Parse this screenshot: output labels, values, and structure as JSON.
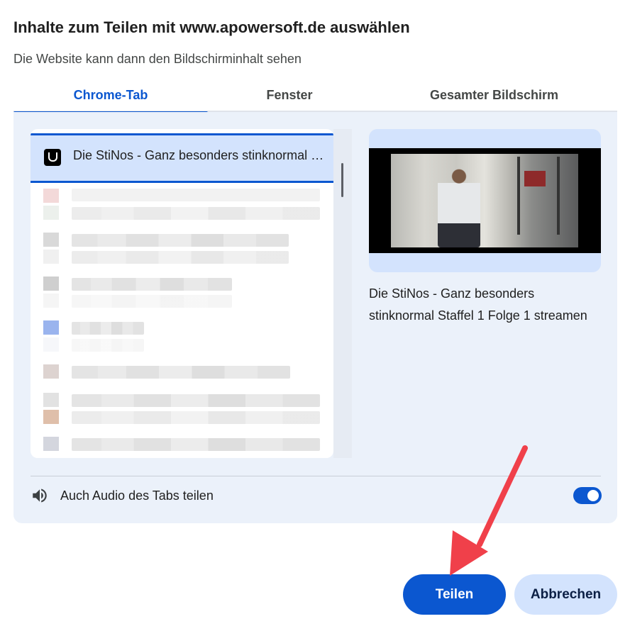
{
  "dialog": {
    "title": "Inhalte zum Teilen mit www.apowersoft.de auswählen",
    "subtitle": "Die Website kann dann den Bildschirminhalt sehen"
  },
  "tabs": [
    {
      "label": "Chrome-Tab",
      "active": true
    },
    {
      "label": "Fenster",
      "active": false
    },
    {
      "label": "Gesamter Bildschirm",
      "active": false
    }
  ],
  "tab_list": {
    "selected_item": {
      "label": "Die StiNos - Ganz besonders stinknormal Staffel 1 Folge 1 streamen",
      "icon": "stinos-favicon"
    },
    "blurred_items_count": 7
  },
  "preview": {
    "title": "Die StiNos - Ganz besonders stinknormal Staffel 1 Folge 1 streamen"
  },
  "audio": {
    "label": "Auch Audio des Tabs teilen",
    "icon": "speaker-icon",
    "enabled": true
  },
  "buttons": {
    "share_label": "Teilen",
    "cancel_label": "Abbrechen"
  },
  "colors": {
    "accent": "#0b57d0",
    "panel_bg": "#ebf1fa",
    "selected_bg": "#d3e3fd",
    "annotation_arrow": "#f0404a"
  }
}
